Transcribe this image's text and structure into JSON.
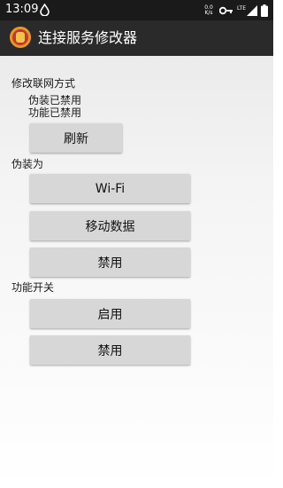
{
  "status_bar": {
    "time": "13:09",
    "network_label": "LTE",
    "network_speed": "0.0\nK/s"
  },
  "app_bar": {
    "title": "连接服务修改器"
  },
  "main": {
    "section_mode": "修改联网方式",
    "status_disguise": "伪装已禁用",
    "status_function": "功能已禁用",
    "refresh_label": "刷新",
    "section_disguise_as": "伪装为",
    "wifi_label": "Wi-Fi",
    "mobile_data_label": "移动数据",
    "disguise_disable_label": "禁用",
    "section_function_switch": "功能开关",
    "enable_label": "启用",
    "function_disable_label": "禁用"
  }
}
